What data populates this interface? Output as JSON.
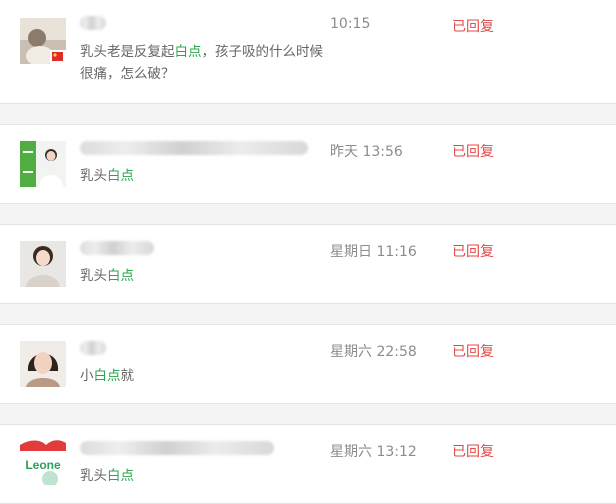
{
  "conversations": [
    {
      "msg_lines": [
        {
          "parts": [
            {
              "t": "乳头老是反复起"
            },
            {
              "t": "白点",
              "hl": true
            },
            {
              "t": "，孩子吸的什么时候"
            }
          ]
        },
        {
          "parts": [
            {
              "t": "很痛，怎么破？"
            }
          ]
        }
      ],
      "time": "10:15",
      "status": "已回复"
    },
    {
      "msg_lines": [
        {
          "parts": [
            {
              "t": "乳头"
            },
            {
              "t": "白点",
              "hl": true
            }
          ]
        }
      ],
      "time": "昨天 13:56",
      "status": "已回复"
    },
    {
      "msg_lines": [
        {
          "parts": [
            {
              "t": "乳头"
            },
            {
              "t": "白点",
              "hl": true
            }
          ]
        }
      ],
      "time": "星期日 11:16",
      "status": "已回复"
    },
    {
      "msg_lines": [
        {
          "parts": [
            {
              "t": "小"
            },
            {
              "t": "白点",
              "hl": true
            },
            {
              "t": "就"
            }
          ]
        }
      ],
      "time": "星期六 22:58",
      "status": "已回复"
    },
    {
      "msg_lines": [
        {
          "parts": [
            {
              "t": "乳头"
            },
            {
              "t": "白点",
              "hl": true
            }
          ]
        }
      ],
      "time": "星期六 13:12",
      "status": "已回复"
    }
  ],
  "logo_text": "Leone",
  "colors": {
    "highlight": "#2da44e",
    "status": "#e04a4a",
    "time": "#8c8c8c"
  }
}
